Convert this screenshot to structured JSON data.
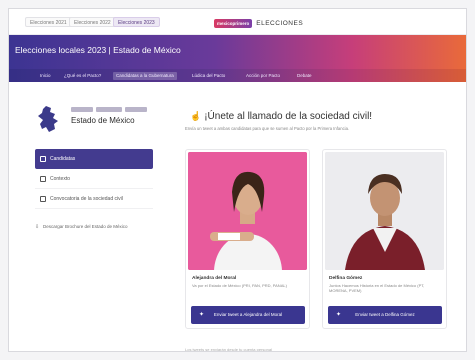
{
  "topbar": {
    "year_tabs": [
      {
        "label": "Elecciones 2021",
        "active": false
      },
      {
        "label": "Elecciones 2022",
        "active": false
      },
      {
        "label": "Elecciones 2023",
        "active": true
      }
    ],
    "brand_logo_text": "mexicoprimero",
    "brand_name": "ELECCIONES"
  },
  "header": {
    "title": "Elecciones locales 2023 | Estado de México"
  },
  "nav": {
    "items": [
      {
        "label": "Inicio",
        "active": false
      },
      {
        "label": "¿Qué es el Pacto?",
        "active": false
      },
      {
        "label": "Candidatas a la Gubernatura",
        "active": true
      },
      {
        "label": "Lúdica del Pacto",
        "active": false
      },
      {
        "label": "Acción por Pacto",
        "active": false
      },
      {
        "label": "Debate",
        "active": false
      }
    ]
  },
  "sidebar": {
    "state_name": "Estado de México",
    "menu": [
      {
        "label": "Candidatas",
        "active": true
      },
      {
        "label": "Contexto",
        "active": false
      },
      {
        "label": "Convocatoria de la sociedad civil",
        "active": false
      }
    ],
    "download_label": "Descargar Brochure del Estado de México"
  },
  "main": {
    "title": "¡Únete al llamado de la sociedad civil!",
    "subtitle": "Envía un tweet a ambas candidatas para que se sumen al Pacto por la Primera Infancia.",
    "cards": [
      {
        "name": "Alejandra del Moral",
        "desc": "Va por el Estado de México (PRI, PAN, PRD, PANAL)",
        "button": "Enviar tweet a Alejandra del Moral",
        "photo_color": "#e85a9c"
      },
      {
        "name": "Delfina Gómez",
        "desc": "Juntos Hacemos Historia en el Estado de México (PT, MORENA, PVEM)",
        "button": "Enviar tweet a Delfina Gómez",
        "photo_color": "#ececef"
      }
    ],
    "footer_note": "Los tweets se enviarán desde tu cuenta personal"
  },
  "colors": {
    "accent": "#3a3690",
    "gradient_start": "#3c3492",
    "gradient_end": "#e96a3a"
  }
}
